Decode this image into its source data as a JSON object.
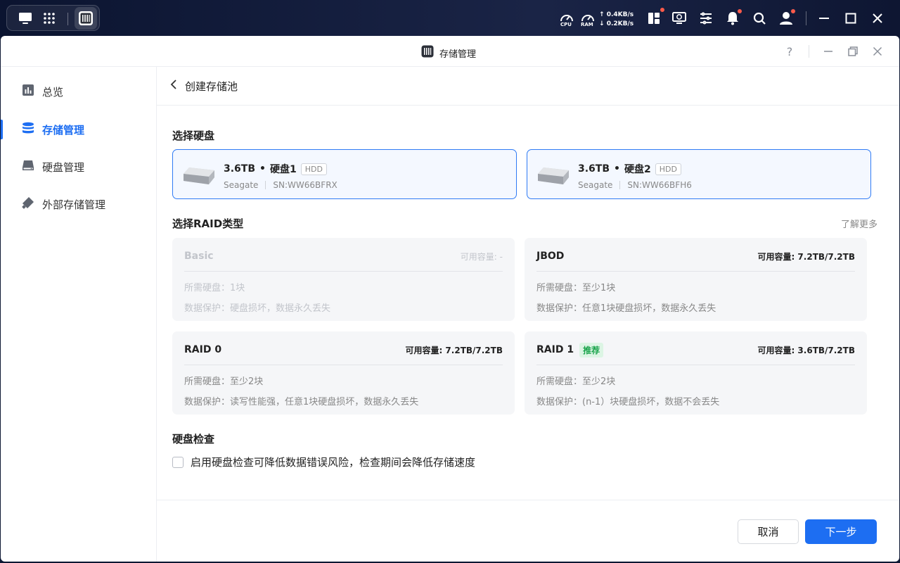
{
  "topbar": {
    "cpu_label": "CPU",
    "ram_label": "RAM",
    "upload": "0.4KB/s",
    "download": "0.2KB/s"
  },
  "window": {
    "title": "存储管理",
    "help": "?"
  },
  "sidebar": {
    "items": [
      {
        "label": "总览",
        "icon": "overview-icon"
      },
      {
        "label": "存储管理",
        "icon": "storage-icon",
        "active": true
      },
      {
        "label": "硬盘管理",
        "icon": "disk-icon"
      },
      {
        "label": "外部存储管理",
        "icon": "external-storage-icon"
      }
    ]
  },
  "page": {
    "breadcrumb": "创建存储池",
    "select_disk_title": "选择硬盘",
    "disks": [
      {
        "size": "3.6TB",
        "sep": "•",
        "name": "硬盘1",
        "type": "HDD",
        "brand": "Seagate",
        "sn": "SN:WW66BFRX",
        "selected": true
      },
      {
        "size": "3.6TB",
        "sep": "•",
        "name": "硬盘2",
        "type": "HDD",
        "brand": "Seagate",
        "sn": "SN:WW66BFH6",
        "selected": true
      }
    ],
    "raid_title": "选择RAID类型",
    "learn_more": "了解更多",
    "raid_types": [
      {
        "name": "Basic",
        "capacity": "可用容量: -",
        "required": "所需硬盘：1块",
        "protection": "数据保护：硬盘损坏，数据永久丢失",
        "disabled": true
      },
      {
        "name": "JBOD",
        "capacity": "可用容量: 7.2TB/7.2TB",
        "required": "所需硬盘：至少1块",
        "protection": "数据保护：任意1块硬盘损坏，数据永久丢失"
      },
      {
        "name": "RAID 0",
        "capacity": "可用容量: 7.2TB/7.2TB",
        "required": "所需硬盘：至少2块",
        "protection": "数据保护：读写性能强，任意1块硬盘损坏，数据永久丢失"
      },
      {
        "name": "RAID 1",
        "tag": "推荐",
        "capacity": "可用容量: 3.6TB/7.2TB",
        "required": "所需硬盘：至少2块",
        "protection": "数据保护：(n-1）块硬盘损坏，数据不会丢失"
      }
    ],
    "disk_check_title": "硬盘检查",
    "disk_check_label": "启用硬盘检查可降低数据错误风险，检查期间会降低存储速度",
    "disk_check_checked": false
  },
  "footer": {
    "cancel": "取消",
    "next": "下一步"
  },
  "colors": {
    "accent": "#1d6ef2",
    "recommend": "#18a34a",
    "notify_dot": "#ff5a4a"
  }
}
